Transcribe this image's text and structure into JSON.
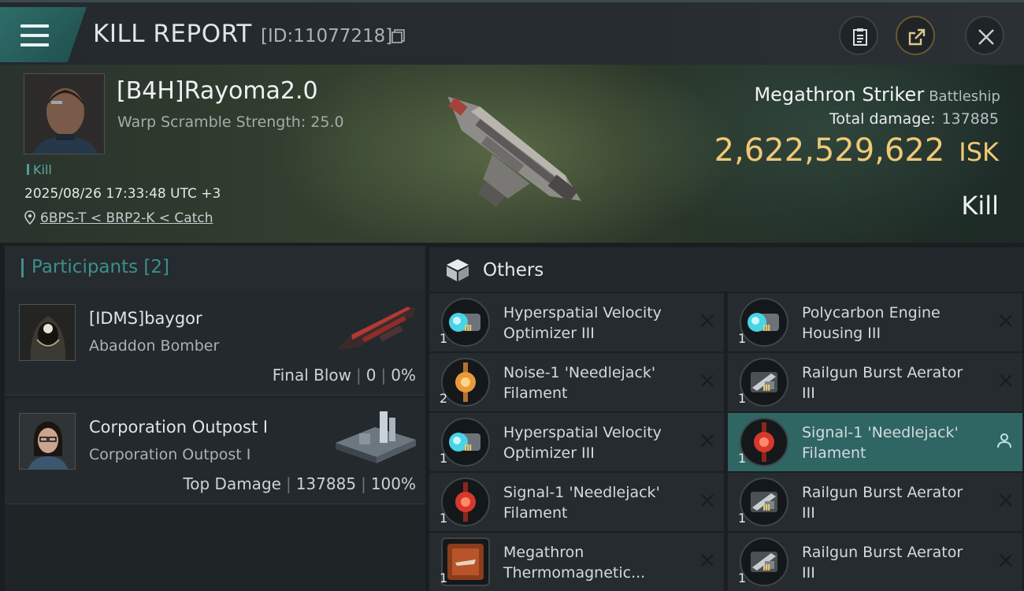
{
  "header": {
    "title": "KILL REPORT",
    "id_text": "[ID:11077218]"
  },
  "victim": {
    "name": "[B4H]Rayoma2.0",
    "warp_scramble": "Warp Scramble Strength: 25.0",
    "kill_tag": "Kill",
    "timestamp": "2025/08/26 17:33:48 UTC +3",
    "location": "6BPS-T < BRP2-K < Catch",
    "ship_name": "Megathron Striker",
    "ship_class": "Battleship",
    "total_damage_label": "Total damage:",
    "total_damage": "137885",
    "isk_value": "2,622,529,622",
    "isk_unit": "ISK",
    "result": "Kill"
  },
  "participants": {
    "title": "Participants [2]",
    "rows": [
      {
        "name": "[IDMS]baygor",
        "ship": "Abaddon Bomber",
        "role": "Final Blow",
        "damage": "0",
        "percent": "0%"
      },
      {
        "name": "Corporation Outpost I",
        "ship": "Corporation Outpost I",
        "role": "Top Damage",
        "damage": "137885",
        "percent": "100%"
      }
    ]
  },
  "others": {
    "title": "Others",
    "items": [
      {
        "line1": "Hyperspatial Velocity",
        "line2": "Optimizer III",
        "qty": "1",
        "icon": "rig-icon",
        "level": "III"
      },
      {
        "line1": "Polycarbon Engine",
        "line2": "Housing III",
        "qty": "1",
        "icon": "rig-icon",
        "level": "III"
      },
      {
        "line1": " Noise-1 'Needlejack'",
        "line2": "Filament",
        "qty": "2",
        "icon": "filament-orange-icon",
        "level": ""
      },
      {
        "line1": "Railgun Burst Aerator",
        "line2": "III",
        "qty": "1",
        "icon": "railgun-rig-icon",
        "level": "III"
      },
      {
        "line1": "Hyperspatial Velocity",
        "line2": "Optimizer III",
        "qty": "1",
        "icon": "rig-icon",
        "level": "III"
      },
      {
        "line1": " Signal-1 'Needlejack'",
        "line2": "Filament",
        "qty": "1",
        "icon": "filament-red-icon",
        "level": ""
      },
      {
        "line1": " Signal-1 'Needlejack'",
        "line2": "Filament",
        "qty": "1",
        "icon": "filament-red-icon",
        "level": ""
      },
      {
        "line1": "Railgun Burst Aerator",
        "line2": "III",
        "qty": "1",
        "icon": "railgun-rig-icon",
        "level": "III"
      },
      {
        "line1": "Megathron",
        "line2": "Thermomagnetic...",
        "qty": "1",
        "icon": "blueprint-icon",
        "level": ""
      },
      {
        "line1": "Railgun Burst Aerator",
        "line2": "III",
        "qty": "1",
        "icon": "railgun-rig-icon",
        "level": "III"
      }
    ]
  },
  "colors": {
    "accent": "#3e8f8b",
    "isk": "#f0c876",
    "selected_row": "#2f6563"
  }
}
